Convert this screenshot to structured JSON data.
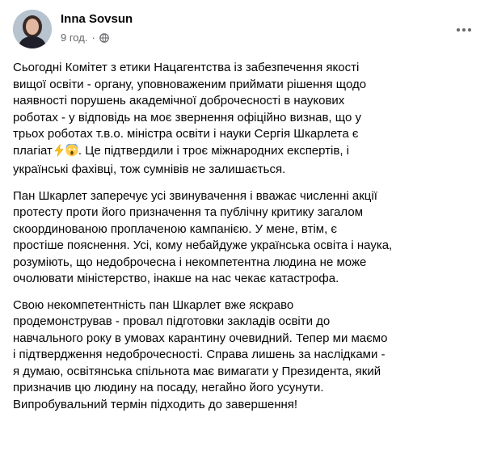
{
  "author": {
    "name": "Inna Sovsun"
  },
  "meta": {
    "time": "9 год.",
    "separator": "·",
    "privacy_icon": "globe-icon"
  },
  "more_icon": "more-dots-icon",
  "post": {
    "p1_a": "Сьогодні Комітет з етики Нацагентства із забезпечення якості\nвищої освіти - органу, уповноваженим приймати рішення щодо\nнаявності порушень академічної доброчесності в наукових\nроботах - у відповідь на моє звернення офіційно визнав, що у\nтрьох роботах т.в.о. міністра освіти і науки Сергія Шкарлета є\nплагіат",
    "p1_emojis": [
      "zap-icon",
      "screaming-face-icon"
    ],
    "p1_b": ". Це підтвердили і троє міжнародних експертів, і\nукраїнські фахівці, тож сумнівів не залишається.",
    "p2": "Пан Шкарлет заперечує усі звинувачення і вважає численні акції\nпротесту проти його призначення та публічну критику загалом\nскоординованою проплаченою кампанією. У мене, втім, є\nпростіше пояснення. Усі, кому небайдуже українська освіта і наука,\nрозуміють, що недоброчесна і некомпетентна людина не може\nочолювати міністерство, інакше на нас чекає катастрофа.",
    "p3": "Свою некомпетентність пан Шкарлет вже яскраво\nпродемонстрував - провал підготовки закладів освіти до\nнавчального року в умовах карантину очевидний. Тепер ми маємо\nі підтвердження недоброчесності. Справа лишень за наслідками -\nя думаю, освітянська спільнота має вимагати у Президента, який\nпризначив цю людину на посаду, негайно його усунути.\nВипробувальний термін підходить до завершення!"
  }
}
